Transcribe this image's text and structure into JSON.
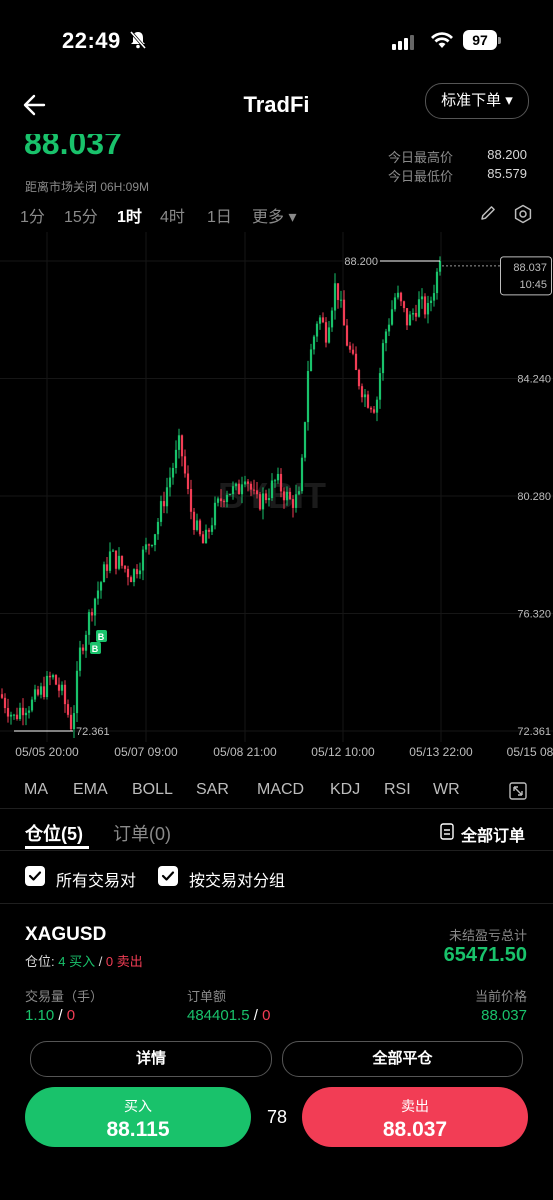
{
  "status": {
    "time": "22:49",
    "battery": "97"
  },
  "header": {
    "title": "TradFi",
    "order_type": "标准下单 ▾"
  },
  "price": {
    "current": "88.037",
    "market_close": "距离市场关闭 06H:09M",
    "high_label": "今日最高价",
    "high_value": "88.200",
    "low_label": "今日最低价",
    "low_value": "85.579"
  },
  "timeframes": [
    "1分",
    "15分",
    "1时",
    "4时",
    "1日",
    "更多 ▾"
  ],
  "active_timeframe": "1时",
  "chart_data": {
    "type": "candlestick",
    "y_ticks": [
      "84.240",
      "80.280",
      "76.320",
      "72.361"
    ],
    "x_ticks": [
      "05/05 20:00",
      "05/07 09:00",
      "05/08 21:00",
      "05/12 10:00",
      "05/13 22:00",
      "05/15 08"
    ],
    "ylim": [
      72.361,
      88.2
    ],
    "high_marker": "88.200",
    "low_marker": "72.361",
    "last_price": "88.037",
    "last_time": "10:45",
    "buy_markers": [
      "B",
      "B"
    ],
    "colors": {
      "up": "#19c26b",
      "down": "#f23d55"
    },
    "watermark": "BYBIT"
  },
  "indicators": [
    "MA",
    "EMA",
    "BOLL",
    "SAR",
    "MACD",
    "KDJ",
    "RSI",
    "WR"
  ],
  "tabs": {
    "positions": "仓位(5)",
    "orders": "订单(0)",
    "all_orders": "全部订单"
  },
  "filters": {
    "all_pairs": "所有交易对",
    "group_by_pair": "按交易对分组"
  },
  "position": {
    "symbol": "XAGUSD",
    "pos_prefix": "仓位: ",
    "buy_text": "4 买入",
    "slash": " / ",
    "sell_text": "0 卖出",
    "pnl_label": "未结盈亏总计",
    "pnl_value": "65471.50",
    "volume_label": "交易量（手）",
    "volume_buy": "1.10",
    "volume_sell": "0",
    "order_amount_label": "订单额",
    "order_amount_buy": "484401.5",
    "order_amount_sell": "0",
    "current_price_label": "当前价格",
    "current_price": "88.037",
    "details_button": "详情",
    "close_all_button": "全部平仓"
  },
  "trade": {
    "buy_label": "买入",
    "buy_price": "88.115",
    "spread": "78",
    "sell_label": "卖出",
    "sell_price": "88.037"
  }
}
